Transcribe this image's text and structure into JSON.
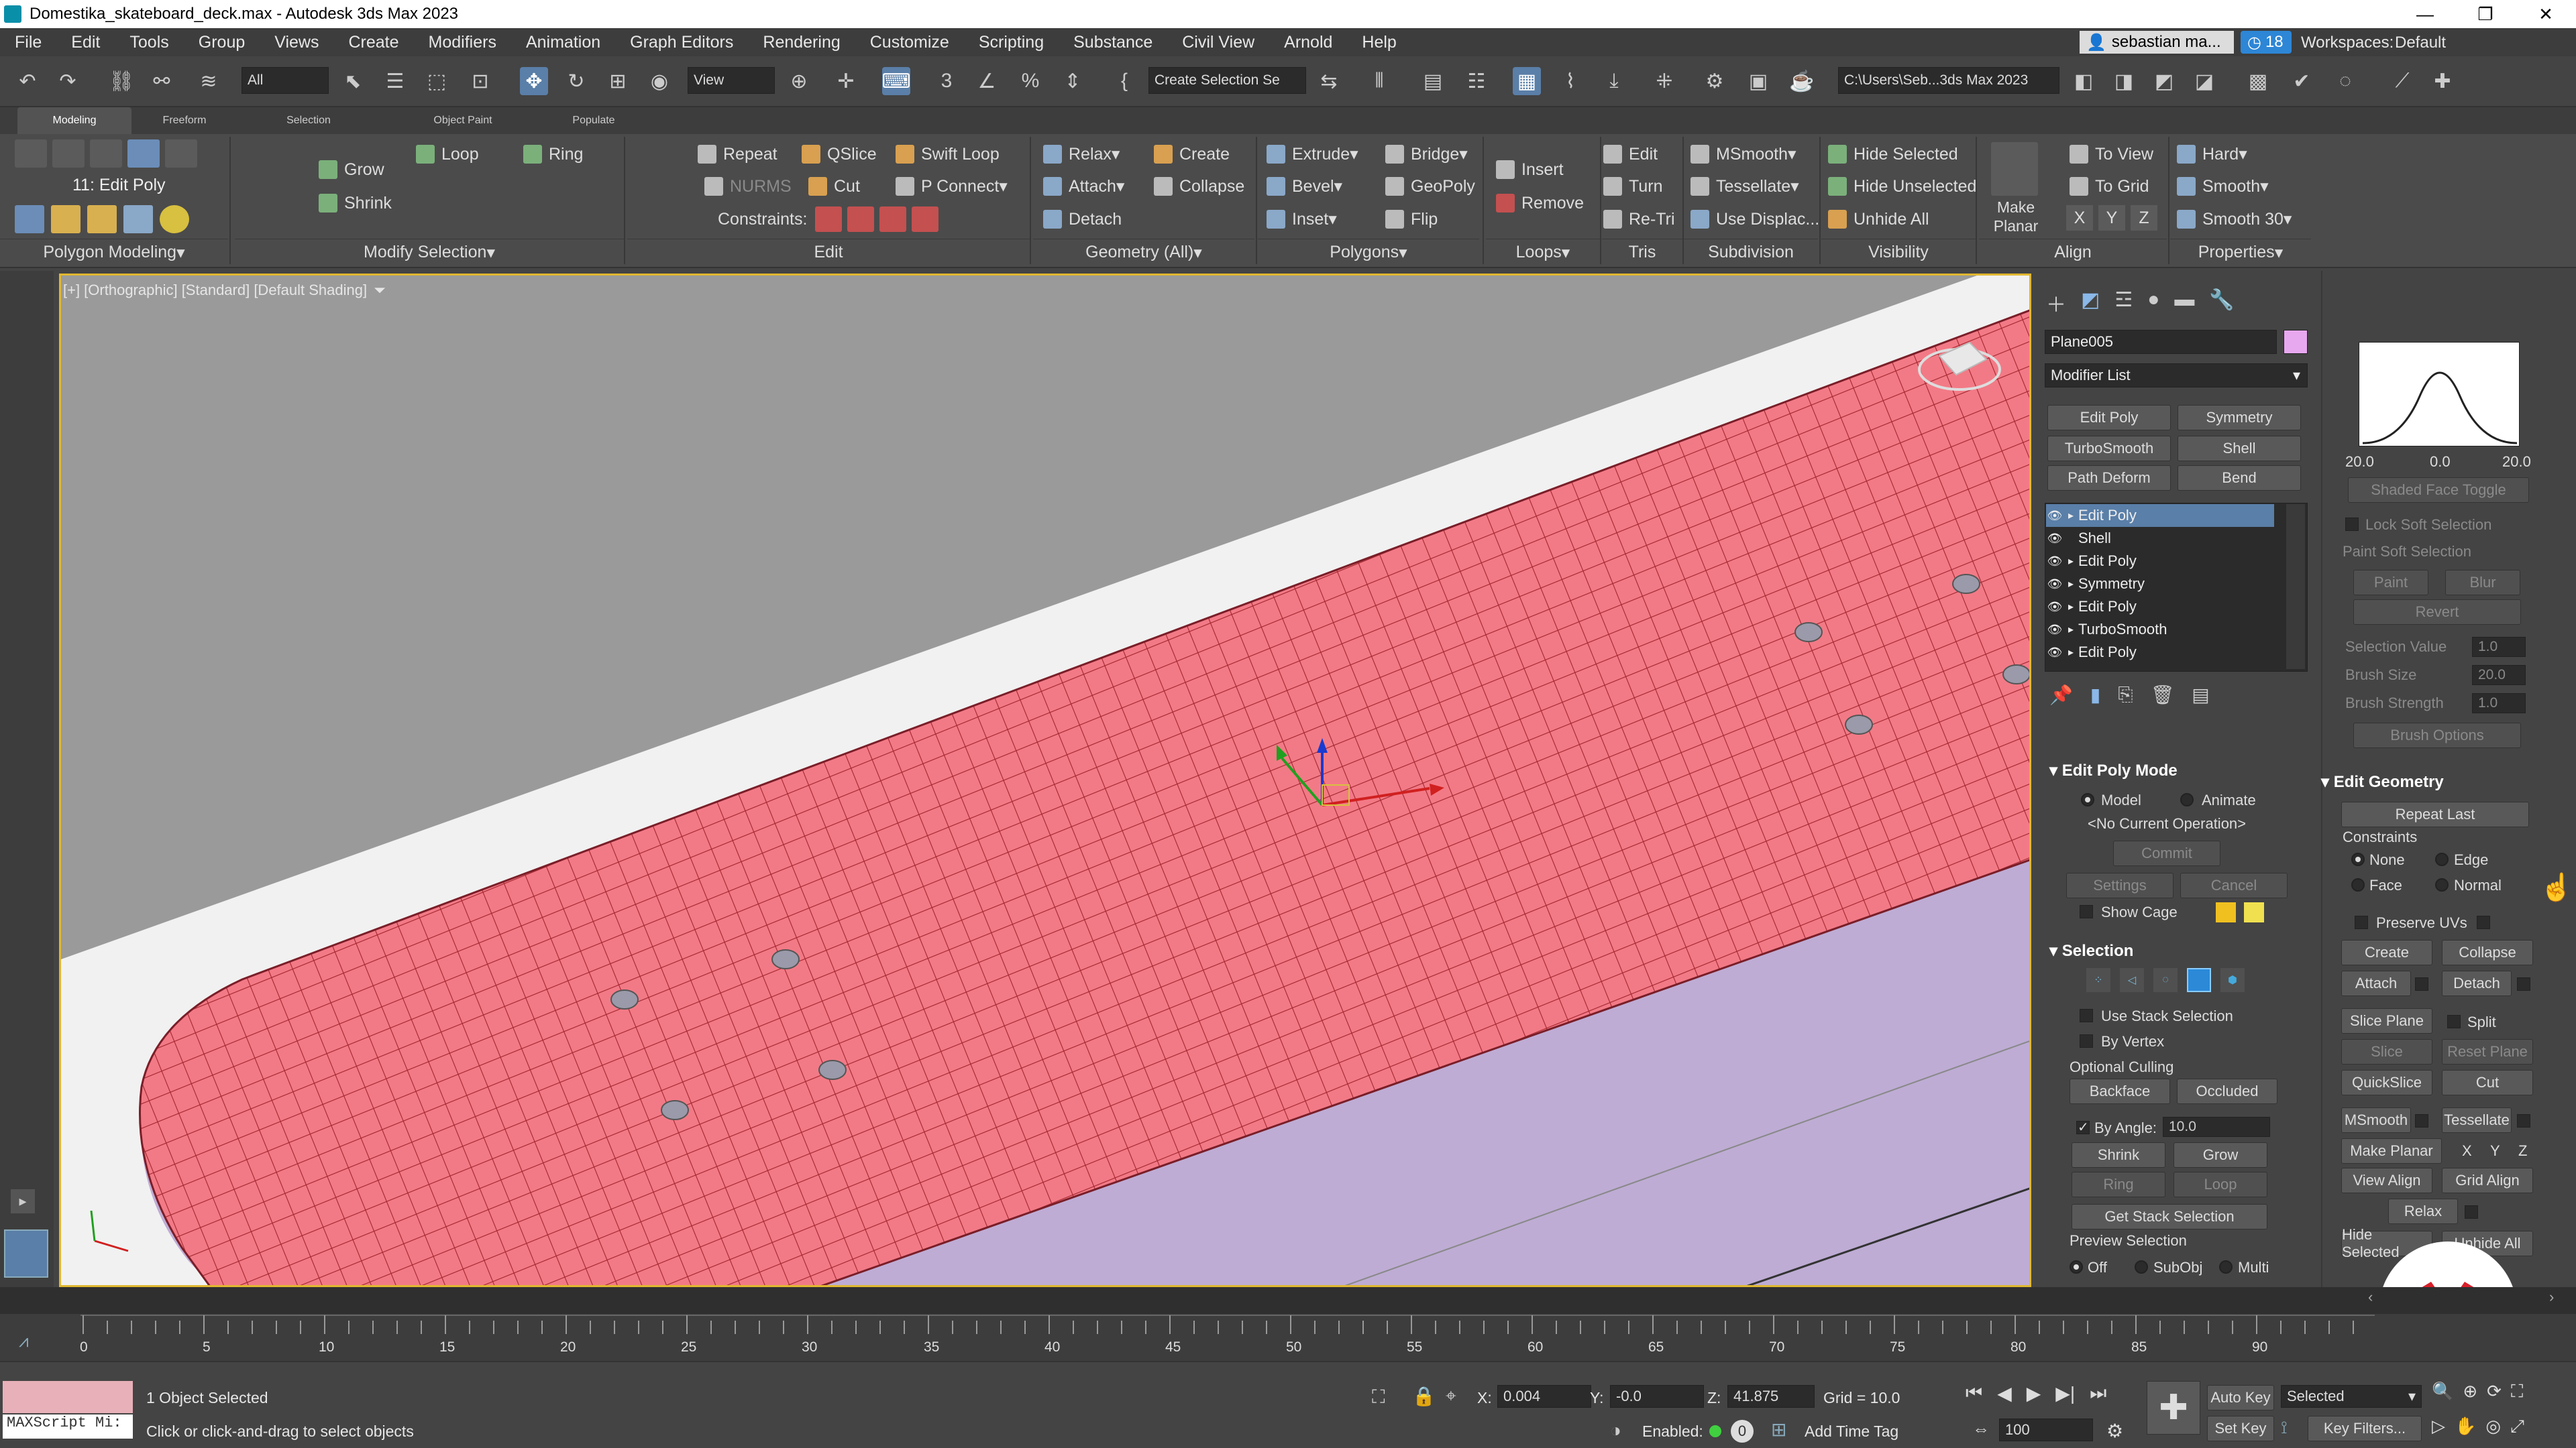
{
  "window": {
    "title": "Domestika_skateboard_deck.max - Autodesk 3ds Max 2023",
    "minimize": "—",
    "maximize": "❐",
    "close": "✕"
  },
  "menu": [
    "File",
    "Edit",
    "Tools",
    "Group",
    "Views",
    "Create",
    "Modifiers",
    "Animation",
    "Graph Editors",
    "Rendering",
    "Customize",
    "Scripting",
    "Substance",
    "Civil View",
    "Arnold",
    "Help"
  ],
  "account": {
    "user": "sebastian ma...",
    "notifications": "18",
    "workspaces_label": "Workspaces:",
    "workspace": "Default"
  },
  "toolbar": {
    "selection_filter": "All",
    "ref_coord": "View",
    "named_selection": "Create Selection Se",
    "project_path": "C:\\Users\\Seb...3ds Max 2023"
  },
  "ribbon": {
    "tabs": [
      "Modeling",
      "Freeform",
      "Selection",
      "Object Paint",
      "Populate"
    ],
    "active_tab": "Modeling",
    "edit_poly_label": "11: Edit Poly",
    "modify_selection": {
      "grow": "Grow",
      "shrink": "Shrink",
      "loop": "Loop",
      "ring": "Ring"
    },
    "edit": {
      "repeat": "Repeat",
      "nurms": "NURMS",
      "qslice": "QSlice",
      "cut": "Cut",
      "swift_loop": "Swift Loop",
      "p_connect": "P Connect",
      "constraints": "Constraints:"
    },
    "geometry": {
      "relax": "Relax",
      "attach": "Attach",
      "detach": "Detach",
      "create": "Create",
      "collapse": "Collapse"
    },
    "polygons": {
      "extrude": "Extrude",
      "bevel": "Bevel",
      "inset": "Inset",
      "bridge": "Bridge",
      "geopoly": "GeoPoly",
      "flip": "Flip"
    },
    "loops": {
      "insert": "Insert",
      "remove": "Remove"
    },
    "tris": {
      "edit": "Edit",
      "turn": "Turn",
      "retri": "Re-Tri"
    },
    "subdivision": {
      "msmooth": "MSmooth",
      "tessellate": "Tessellate",
      "use_displace": "Use Displac..."
    },
    "visibility": {
      "hide_selected": "Hide Selected",
      "hide_unselected": "Hide Unselected",
      "unhide_all": "Unhide All"
    },
    "align": {
      "make_planar": "Make Planar",
      "to_view": "To View",
      "to_grid": "To Grid",
      "x": "X",
      "y": "Y",
      "z": "Z"
    },
    "properties": {
      "hard": "Hard",
      "smooth": "Smooth",
      "smooth30": "Smooth 30"
    },
    "groups": [
      "Polygon Modeling",
      "Modify Selection",
      "Edit",
      "Geometry (All)",
      "Polygons",
      "Loops",
      "Tris",
      "Subdivision",
      "Visibility",
      "Align",
      "Properties"
    ]
  },
  "viewport": {
    "label": "[+] [Orthographic] [Standard] [Default Shading]"
  },
  "command_panel": {
    "object_name": "Plane005",
    "object_color": "#e8a8f0",
    "modifier_list": "Modifier List",
    "quick_buttons": [
      "Edit Poly",
      "Symmetry",
      "TurboSmooth",
      "Shell",
      "Path Deform",
      "Bend"
    ],
    "stack": [
      "Edit Poly",
      "Shell",
      "Edit Poly",
      "Symmetry",
      "Edit Poly",
      "TurboSmooth",
      "Edit Poly"
    ],
    "edit_poly_mode": {
      "title": "Edit Poly Mode",
      "model": "Model",
      "animate": "Animate",
      "current_op": "<No Current Operation>",
      "commit": "Commit",
      "settings": "Settings",
      "cancel": "Cancel",
      "show_cage": "Show Cage"
    },
    "selection": {
      "title": "Selection",
      "use_stack": "Use Stack Selection",
      "by_vertex": "By Vertex",
      "optional_culling": "Optional Culling",
      "backface": "Backface",
      "occluded": "Occluded",
      "by_angle": "By Angle:",
      "angle_value": "10.0",
      "shrink": "Shrink",
      "grow": "Grow",
      "ring": "Ring",
      "loop": "Loop",
      "get_stack": "Get Stack Selection",
      "preview": "Preview Selection",
      "off": "Off",
      "subobj": "SubObj",
      "multi": "Multi"
    }
  },
  "right_panel": {
    "curve_labels": [
      "20.0",
      "0.0",
      "20.0"
    ],
    "shaded_face_toggle": "Shaded Face Toggle",
    "lock_soft": "Lock Soft Selection",
    "paint_soft": "Paint Soft Selection",
    "paint": "Paint",
    "blur": "Blur",
    "revert": "Revert",
    "selection_value": "Selection Value",
    "selection_value_num": "1.0",
    "brush_size": "Brush Size",
    "brush_size_num": "20.0",
    "brush_strength": "Brush Strength",
    "brush_strength_num": "1.0",
    "brush_options": "Brush Options",
    "edit_geometry": "Edit Geometry",
    "repeat_last": "Repeat Last",
    "constraints": "Constraints",
    "none": "None",
    "edge": "Edge",
    "face": "Face",
    "normal": "Normal",
    "preserve_uvs": "Preserve UVs",
    "create": "Create",
    "collapse": "Collapse",
    "attach": "Attach",
    "detach": "Detach",
    "slice_plane": "Slice Plane",
    "split": "Split",
    "slice": "Slice",
    "reset_plane": "Reset Plane",
    "quickslice": "QuickSlice",
    "cut": "Cut",
    "msmooth": "MSmooth",
    "tessellate": "Tessellate",
    "make_planar": "Make Planar",
    "x": "X",
    "y": "Y",
    "z": "Z",
    "view_align": "View Align",
    "grid_align": "Grid Align",
    "relax": "Relax",
    "hide_selected": "Hide Selected",
    "unhide_all": "Unhide All"
  },
  "timeline": {
    "ticks": [
      "0",
      "5",
      "10",
      "15",
      "20",
      "25",
      "30",
      "35",
      "40",
      "45",
      "50",
      "55",
      "60",
      "65",
      "70",
      "75",
      "80",
      "85",
      "90"
    ]
  },
  "status": {
    "maxscript": "MAXScript Mi:",
    "objects_selected": "1 Object Selected",
    "prompt": "Click or click-and-drag to select objects",
    "x_label": "X:",
    "x": "0.004",
    "y_label": "Y:",
    "y": "-0.0",
    "z_label": "Z:",
    "z": "41.875",
    "grid": "Grid = 10.0",
    "enabled": "Enabled:",
    "add_time_tag": "Add Time Tag",
    "auto_key": "Auto Key",
    "set_key": "Set Key",
    "selected": "Selected",
    "key_filters": "Key Filters...",
    "frame": "100"
  }
}
